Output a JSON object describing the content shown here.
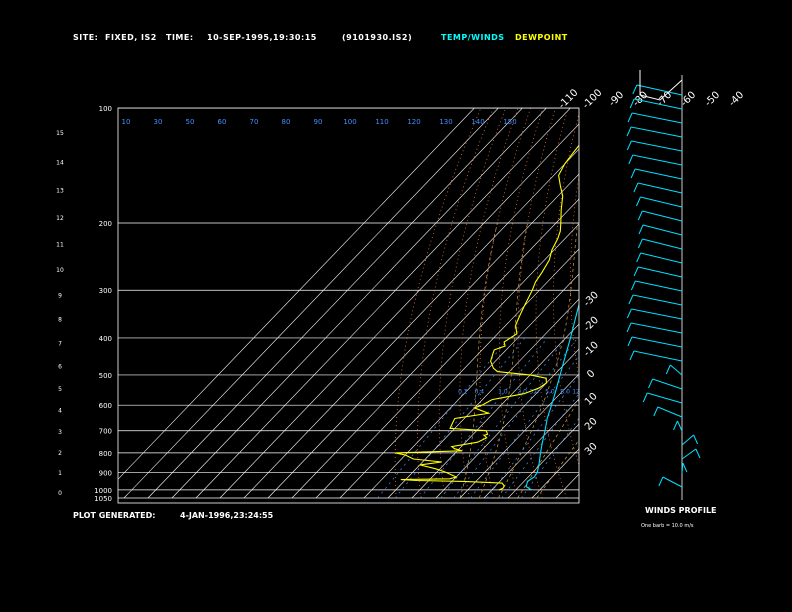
{
  "header": {
    "site_label": "SITE:",
    "site_value": "FIXED, IS2",
    "time_label": "TIME:",
    "time_value": "10-SEP-1995,19:30:15",
    "file_id": "(9101930.IS2)",
    "legend_temp": "TEMP/WINDS",
    "legend_dew": "DEWPOINT"
  },
  "footer": {
    "generated_label": "PLOT GENERATED:",
    "generated_value": "4-JAN-1996,23:24:55",
    "winds_title": "WINDS PROFILE",
    "barb_note": "One barb = 10.0 m/s"
  },
  "colors": {
    "background": "#000000",
    "temp": "#00e0ff",
    "dewpoint": "#ffff00",
    "isotherm": "#ffffff",
    "dry_adiabat": "#ff8040",
    "moist_adiabat": "#d0a040",
    "mixing_ratio": "#4090ff",
    "legend_temp": "#00ffff",
    "legend_dew": "#ffff00"
  },
  "chart_data": {
    "type": "skew-t log-p",
    "pressure_levels": [
      "100",
      "200",
      "300",
      "400",
      "500",
      "600",
      "700",
      "800",
      "900",
      "1000",
      "1050"
    ],
    "pressure_lim": [
      1050,
      100
    ],
    "height_km_ticks": [
      "0",
      "1",
      "2",
      "3",
      "4",
      "5",
      "6",
      "7",
      "8",
      "9",
      "10",
      "11",
      "12",
      "13",
      "14",
      "15"
    ],
    "skewed_temp_ticks_top": [
      "-110",
      "-100",
      "-90",
      "-80",
      "-70",
      "-60",
      "-50",
      "-40"
    ],
    "skewed_temp_ticks_right": [
      "-30",
      "-20",
      "-10",
      "0",
      "10",
      "20",
      "30"
    ],
    "mixing_ratio_labels": [
      "0.2",
      "0.4",
      "1.0",
      "2.0",
      "3.0",
      "5.0",
      "8.0",
      "12.0",
      "20.0"
    ],
    "isotherm_labels_top": [
      "10",
      "30",
      "50",
      "60",
      "70",
      "80",
      "90",
      "100",
      "110",
      "120",
      "130",
      "140",
      "150"
    ],
    "series": [
      {
        "name": "TEMP/WINDS",
        "points": [
          [
            1000,
            26.5
          ],
          [
            980,
            23
          ],
          [
            950,
            21.5
          ],
          [
            925,
            22.5
          ],
          [
            900,
            22
          ],
          [
            850,
            19
          ],
          [
            800,
            15.5
          ],
          [
            750,
            12
          ],
          [
            700,
            8.5
          ],
          [
            650,
            4.5
          ],
          [
            600,
            1
          ],
          [
            550,
            -3
          ],
          [
            500,
            -7.5
          ],
          [
            450,
            -12.5
          ],
          [
            400,
            -18
          ],
          [
            350,
            -24.5
          ],
          [
            300,
            -32
          ],
          [
            250,
            -41
          ],
          [
            210,
            -51
          ],
          [
            200,
            -53
          ],
          [
            180,
            -52
          ],
          [
            160,
            -52.5
          ],
          [
            140,
            -55
          ],
          [
            120,
            -57
          ],
          [
            100,
            -61
          ]
        ]
      },
      {
        "name": "DEWPOINT",
        "points": [
          [
            1000,
            13
          ],
          [
            990,
            14
          ],
          [
            975,
            13.5
          ],
          [
            960,
            11.5
          ],
          [
            950,
            -5
          ],
          [
            945,
            -25
          ],
          [
            940,
            -32
          ],
          [
            935,
            -12
          ],
          [
            925,
            -10
          ],
          [
            900,
            -16
          ],
          [
            880,
            -22
          ],
          [
            860,
            -30
          ],
          [
            845,
            -22
          ],
          [
            830,
            -35
          ],
          [
            810,
            -40
          ],
          [
            800,
            -45
          ],
          [
            790,
            -18
          ],
          [
            780,
            -22
          ],
          [
            770,
            -24
          ],
          [
            750,
            -15
          ],
          [
            740,
            -14
          ],
          [
            730,
            -13
          ],
          [
            720,
            -15
          ],
          [
            715,
            -14
          ],
          [
            700,
            -16
          ],
          [
            690,
            -32
          ],
          [
            670,
            -33
          ],
          [
            650,
            -34
          ],
          [
            630,
            -22
          ],
          [
            610,
            -30
          ],
          [
            600,
            -28
          ],
          [
            580,
            -26
          ],
          [
            560,
            -15
          ],
          [
            540,
            -11
          ],
          [
            525,
            -10
          ],
          [
            510,
            -12
          ],
          [
            500,
            -20
          ],
          [
            490,
            -35
          ],
          [
            480,
            -38
          ],
          [
            470,
            -40
          ],
          [
            460,
            -42
          ],
          [
            450,
            -43
          ],
          [
            440,
            -44
          ],
          [
            430,
            -45
          ],
          [
            420,
            -42
          ],
          [
            410,
            -44
          ],
          [
            400,
            -43
          ],
          [
            390,
            -42
          ],
          [
            380,
            -44
          ],
          [
            370,
            -46
          ],
          [
            350,
            -48
          ],
          [
            330,
            -50
          ],
          [
            310,
            -52
          ],
          [
            300,
            -53
          ],
          [
            285,
            -55
          ],
          [
            270,
            -56
          ],
          [
            250,
            -58
          ],
          [
            235,
            -61
          ],
          [
            220,
            -63
          ],
          [
            210,
            -65
          ],
          [
            200,
            -68
          ],
          [
            185,
            -73
          ],
          [
            170,
            -78
          ],
          [
            160,
            -83
          ],
          [
            150,
            -88
          ],
          [
            140,
            -90
          ],
          [
            130,
            -91
          ],
          [
            120,
            -92
          ],
          [
            110,
            -93
          ],
          [
            105,
            -90
          ],
          [
            100,
            -87
          ]
        ]
      }
    ],
    "winds_profile": {
      "x_axis_label": "WINDS PROFILE",
      "units": "m/s",
      "barb_value": 10.0
    },
    "grid": true,
    "legend_position": "top-center"
  }
}
